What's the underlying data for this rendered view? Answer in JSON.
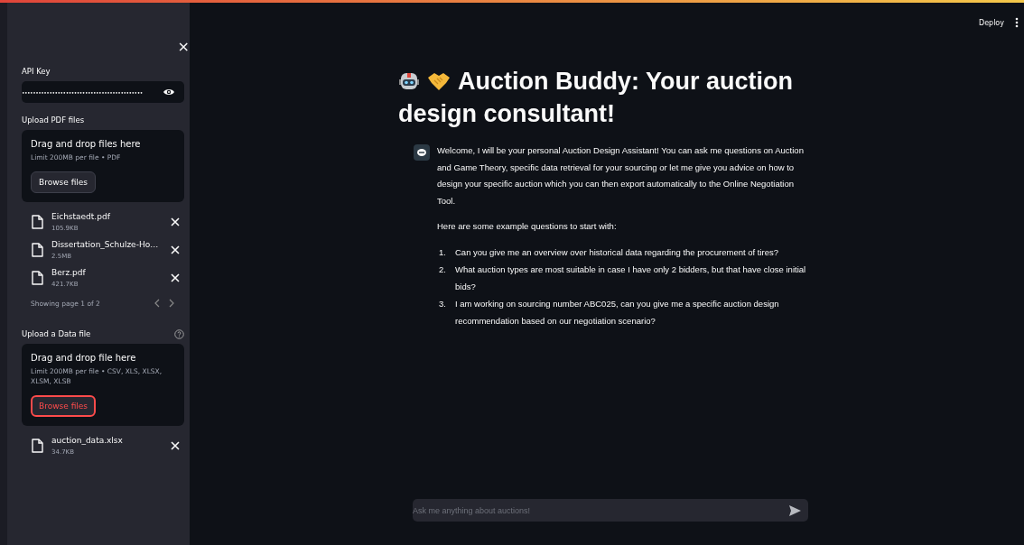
{
  "sidebar": {
    "close": "×",
    "api_key": {
      "label": "API Key",
      "value": "••••••••••••••••••••••••••••••••••••••••••••",
      "masked": true
    },
    "pdf_upload": {
      "label": "Upload PDF files",
      "drop_title": "Drag and drop files here",
      "limit": "Limit 200MB per file • PDF",
      "button": {
        "label": "Browse files",
        "focused": false
      },
      "files": [
        {
          "name": "Eichstaedt.pdf",
          "size": "105.9KB"
        },
        {
          "name": "Dissertation_Schulze-Ho…",
          "size": "2.5MB"
        },
        {
          "name": "Berz.pdf",
          "size": "421.7KB"
        }
      ],
      "pagination": "Showing page 1 of 2"
    },
    "data_upload": {
      "label": "Upload a Data file",
      "help": true,
      "drop_title": "Drag and drop file here",
      "limit": "Limit 200MB per file • CSV, XLS, XLSX, XLSM, XLSB",
      "button": {
        "label": "Browse files",
        "focused": true
      },
      "files": [
        {
          "name": "auction_data.xlsx",
          "size": "34.7KB"
        }
      ]
    }
  },
  "header": {
    "deploy": "Deploy"
  },
  "main": {
    "title_lines": [
      "Auction Buddy: Your auction",
      "design consultant!"
    ],
    "message": {
      "paragraphs": [
        "Welcome, I will be your personal Auction Design Assistant! You can ask me questions on Auction and Game Theory, specific data retrieval for your sourcing or let me give you advice on how to design your specific auction which you can then export automatically to the Online Negotiation Tool.",
        "Here are some example questions to start with:"
      ],
      "questions": [
        {
          "number": "1.",
          "text": "Can you give me an overview over historical data regarding the procurement of tires?"
        },
        {
          "number": "2.",
          "text": "What auction types are most suitable in case I have only 2 bidders, but that have close initial bids?"
        },
        {
          "number": "3.",
          "text": "I am working on sourcing number ABC025, can you give me a specific auction design recommendation based on our negotiation scenario?"
        }
      ]
    },
    "chat_input": {
      "placeholder": "Ask me anything about auctions!"
    }
  }
}
